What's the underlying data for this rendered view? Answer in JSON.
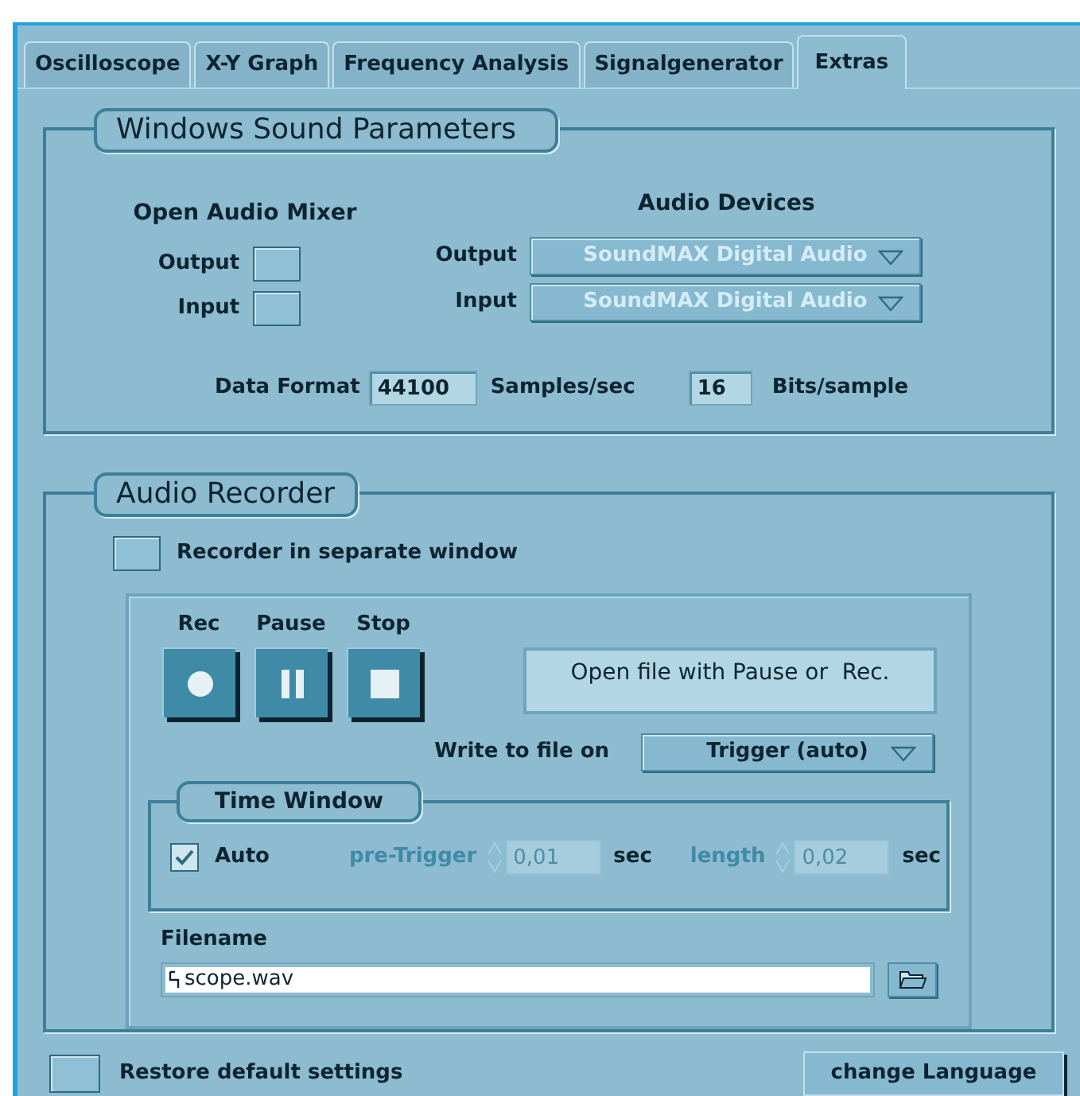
{
  "tabs": [
    {
      "label": "Oscilloscope",
      "selected": false
    },
    {
      "label": "X-Y Graph",
      "selected": false
    },
    {
      "label": "Frequency Analysis",
      "selected": false
    },
    {
      "label": "Signalgenerator",
      "selected": false
    },
    {
      "label": "Extras",
      "selected": true
    }
  ],
  "sound_parameters": {
    "title": "Windows Sound Parameters",
    "mixer": {
      "heading": "Open Audio Mixer",
      "buttons": [
        {
          "label": "Output"
        },
        {
          "label": "Input"
        }
      ]
    },
    "devices": {
      "heading": "Audio Devices",
      "selects": [
        {
          "label": "Output",
          "value": "SoundMAX Digital Audio",
          "disabled": true
        },
        {
          "label": "Input",
          "value": "SoundMAX Digital Audio",
          "disabled": true
        }
      ]
    },
    "data_format": {
      "label": "Data Format",
      "rate": "44100",
      "rate_unit": "Samples/sec",
      "bits": "16",
      "bits_unit": "Bits/sample"
    }
  },
  "recorder": {
    "title": "Audio Recorder",
    "separate_window": {
      "label": "Recorder in separate window",
      "on": false
    },
    "transport": [
      {
        "kind": "rec",
        "label": "Rec"
      },
      {
        "kind": "pause",
        "label": "Pause"
      },
      {
        "kind": "stop",
        "label": "Stop"
      }
    ],
    "message": "Open file with Pause or  Rec.",
    "write_on": {
      "label": "Write to file on",
      "value": "Trigger (auto)"
    },
    "time_window": {
      "title": "Time Window",
      "auto": {
        "label": "Auto",
        "checked": true
      },
      "fields": [
        {
          "label": "pre-Trigger",
          "value": "0,01",
          "unit": "sec",
          "disabled": true
        },
        {
          "label": "length",
          "value": "0,02",
          "unit": "sec",
          "disabled": true
        }
      ]
    },
    "filename": {
      "label": "Filename",
      "value": "scope.wav"
    }
  },
  "restore": {
    "label": "Restore default settings"
  },
  "language_button": "change Language"
}
